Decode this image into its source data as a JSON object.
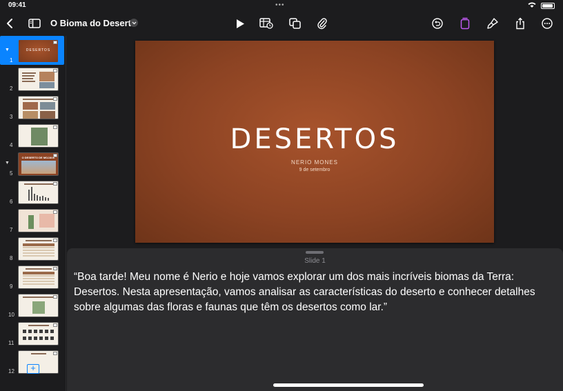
{
  "status": {
    "time": "09:41",
    "dots": "•••"
  },
  "toolbar": {
    "title": "O Bioma do Deserto",
    "buttons": [
      "back",
      "sidebar",
      "play",
      "table",
      "shapes",
      "attach",
      "undo",
      "format-active",
      "brush",
      "share",
      "more"
    ]
  },
  "navigator": {
    "slides": [
      {
        "num": "1",
        "kind": "title",
        "label": "DESERTOS"
      },
      {
        "num": "2",
        "kind": "text-img"
      },
      {
        "num": "3",
        "kind": "grid-img"
      },
      {
        "num": "4",
        "kind": "map"
      },
      {
        "num": "5",
        "kind": "section",
        "label": "O DESERTO DE MOJAVE"
      },
      {
        "num": "6",
        "kind": "chart"
      },
      {
        "num": "7",
        "kind": "cactus"
      },
      {
        "num": "8",
        "kind": "table"
      },
      {
        "num": "9",
        "kind": "table2"
      },
      {
        "num": "10",
        "kind": "diagram"
      },
      {
        "num": "11",
        "kind": "animals"
      },
      {
        "num": "12",
        "kind": "text"
      }
    ]
  },
  "slide": {
    "title": "DESERTOS",
    "author": "NERIO MONES",
    "date": "9 de setembro",
    "bg_color": "#8c4323"
  },
  "notes": {
    "label": "Slide 1",
    "text": "“Boa tarde! Meu nome é Nerio e hoje vamos explorar um dos mais incríveis biomas da Terra: Desertos. Nesta apresentação, vamos analisar as características do deserto e conhecer detalhes sobre algumas das floras e faunas que têm os desertos como lar.”"
  }
}
